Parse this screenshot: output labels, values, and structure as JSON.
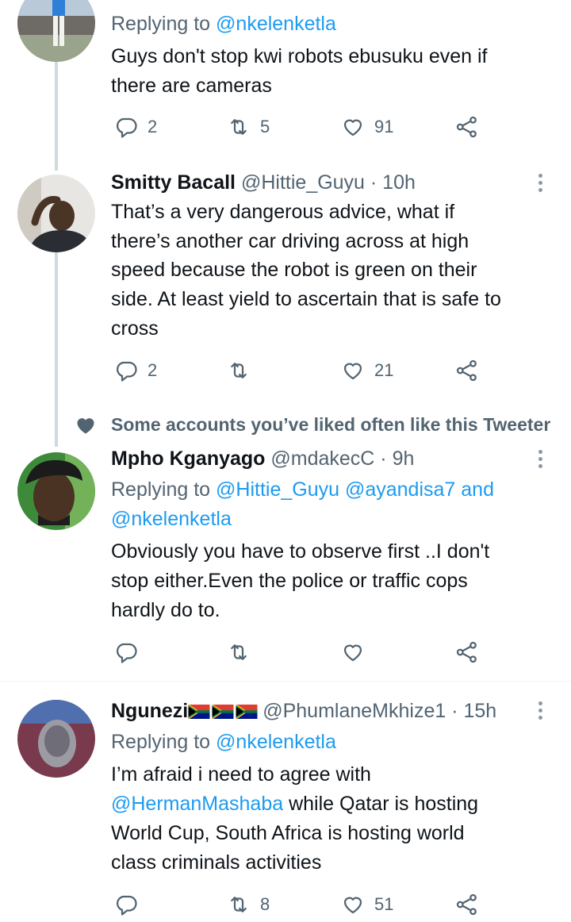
{
  "tweet1": {
    "replying_prefix": "Replying to ",
    "replying_to": "@nkelenketla",
    "text_lines": [
      "Guys don't stop kwi robots ebusuku even if",
      "there are cameras"
    ],
    "replies": "2",
    "retweets": "5",
    "likes": "91"
  },
  "tweet2": {
    "name": "Smitty Bacall",
    "meta": " @Hittie_Guyu · 10h",
    "text_lines": [
      "That’s a very dangerous advice, what if",
      "there’s another car driving across at high",
      "speed because the robot is green on their",
      "side. At least yield to ascertain that is safe to",
      "cross"
    ],
    "replies": "2",
    "retweets": "",
    "likes": "21"
  },
  "social_context": "Some accounts you’ve liked often like this Tweeter",
  "tweet3": {
    "name": "Mpho Kganyago",
    "meta": " @mdakecC · 9h",
    "replying_prefix": "Replying to ",
    "replying_line1": "@Hittie_Guyu @ayandisa7 and",
    "replying_line2": "@nkelenketla",
    "text_lines": [
      "Obviously you have to observe first ..I don't",
      "stop either.Even the police or traffic cops",
      "hardly do to."
    ],
    "replies": "",
    "retweets": "",
    "likes": ""
  },
  "tweet4": {
    "name": "Ngunezi",
    "meta": "@PhumlaneMkhize1 · 15h",
    "replying_prefix": "Replying to ",
    "replying_to": "@nkelenketla",
    "text_line1": "I’m afraid i need to agree with",
    "mention": "@HermanMashaba",
    "text_line2_rest": " while Qatar is hosting",
    "text_lines": [
      "World Cup,  South Africa is hosting world",
      "class criminals activities"
    ],
    "replies": "",
    "retweets": "8",
    "likes": "51"
  },
  "colors": {
    "link": "#1d9bf0",
    "muted": "#536471",
    "line": "#cfd9de"
  },
  "icons": [
    "reply-icon",
    "retweet-icon",
    "like-icon",
    "share-icon",
    "more-icon",
    "heart-filled-icon",
    "south-africa-flag-icon"
  ]
}
